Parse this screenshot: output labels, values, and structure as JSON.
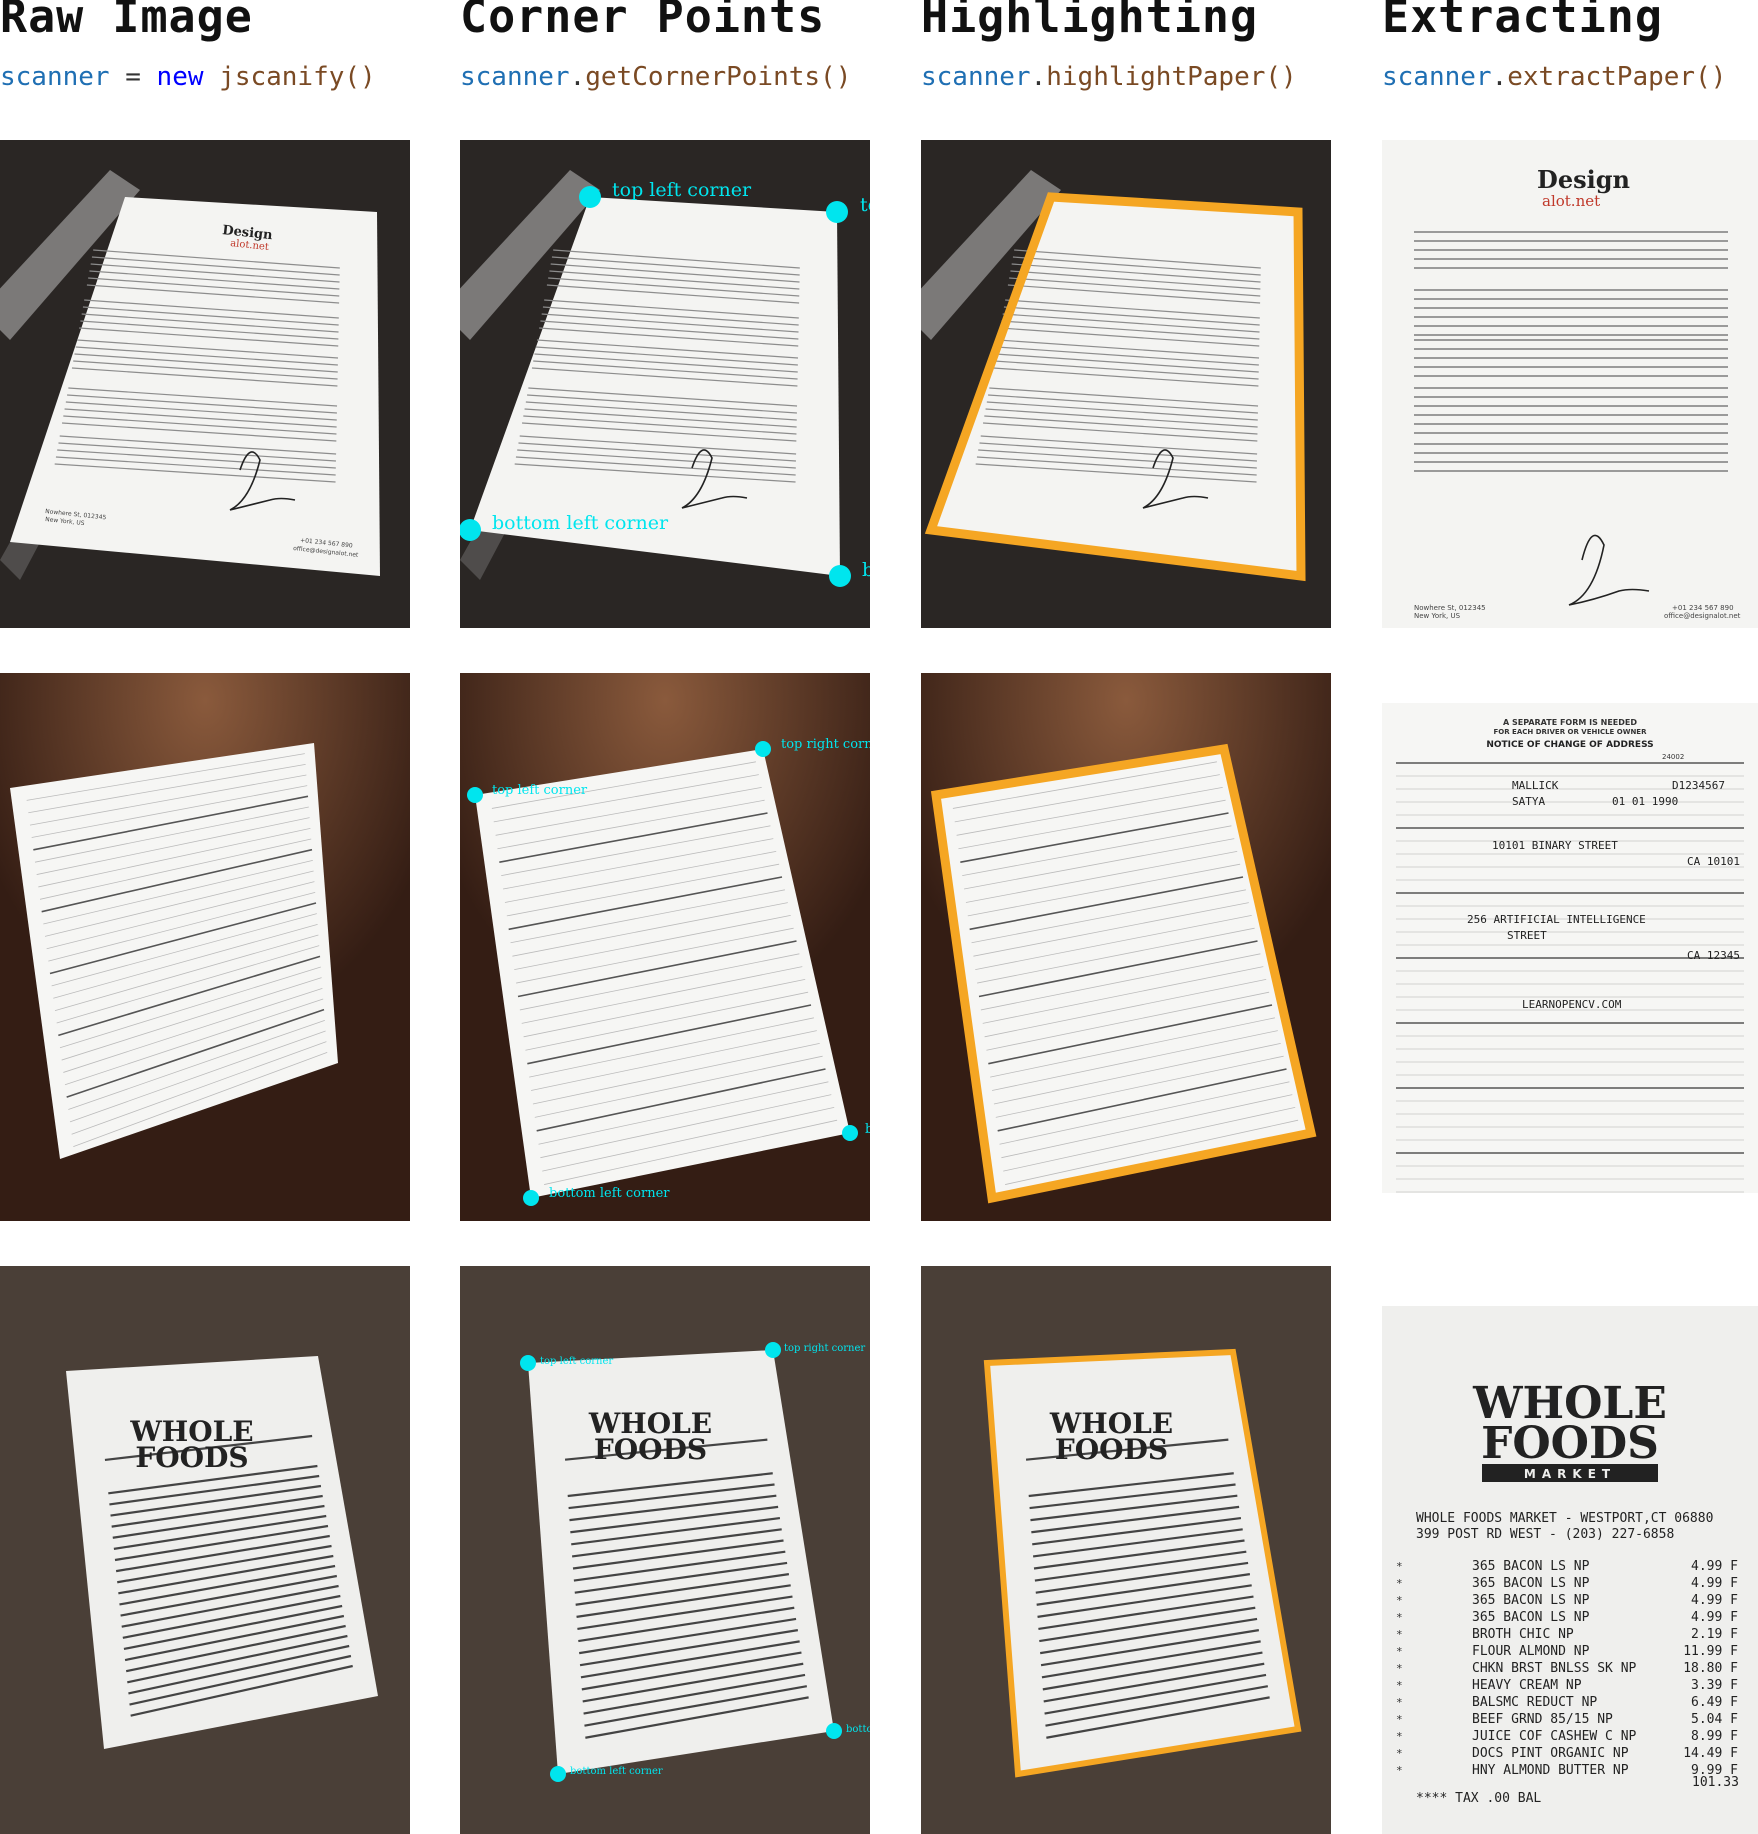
{
  "columns": [
    {
      "title": "Raw Image",
      "code": {
        "var": "scanner",
        "op": " = ",
        "kw": "new",
        "fn": " jscanify()"
      }
    },
    {
      "title": "Corner Points",
      "code": {
        "var": "scanner",
        "op": ".",
        "kw": "",
        "fn": "getCornerPoints()"
      }
    },
    {
      "title": "Highlighting",
      "code": {
        "var": "scanner",
        "op": ".",
        "kw": "",
        "fn": "highlightPaper()"
      }
    },
    {
      "title": "Extracting",
      "code": {
        "var": "scanner",
        "op": ".",
        "kw": "",
        "fn": "extractPaper()"
      }
    }
  ],
  "corner_labels": {
    "top_left": "top left corner",
    "top_right": "top right corner",
    "bottom_left": "bottom left corner",
    "bottom_right": "bottom right corner"
  },
  "colors": {
    "corner_point": "#00e5ee",
    "highlight": "#f5a623",
    "desk_dark": "#2a2624",
    "wood": "#3b2319",
    "receipt_bg": "#4a3f37",
    "paper": "#f4f4f2"
  },
  "letter": {
    "logo_top": "Design",
    "logo_bottom": "alot.net",
    "address": "Nowhere St, 012345",
    "city": "New York, US",
    "phone": "+01 234 567 890",
    "email": "office@designalot.net"
  },
  "form": {
    "header1": "A SEPARATE FORM IS NEEDED",
    "header2": "FOR EACH DRIVER OR VEHICLE OWNER",
    "title": "NOTICE OF CHANGE OF ADDRESS",
    "code": "24002",
    "entries": [
      "MALLICK",
      "D1234567",
      "SATYA",
      "01  01  1990",
      "10101  BINARY  STREET",
      "CA  10101",
      "256  ARTIFICIAL  INTELLIGENCE",
      "STREET",
      "CA  12345",
      "LEARNOPENCV.COM"
    ]
  },
  "receipt": {
    "brand_top": "WHOLE",
    "brand_bottom": "FOODS",
    "market": "MARKET",
    "store": "WHOLE FOODS MARKET - WESTPORT,CT 06880",
    "addr": "399 POST RD WEST - (203) 227-6858",
    "items": [
      {
        "name": "365     BACON LS NP",
        "price": "4.99 F"
      },
      {
        "name": "365     BACON LS NP",
        "price": "4.99 F"
      },
      {
        "name": "365     BACON LS NP",
        "price": "4.99 F"
      },
      {
        "name": "365     BACON LS NP",
        "price": "4.99 F"
      },
      {
        "name": "BROTH CHIC NP",
        "price": "2.19 F"
      },
      {
        "name": "FLOUR ALMOND NP",
        "price": "11.99 F"
      },
      {
        "name": "CHKN BRST BNLSS SK NP",
        "price": "18.80 F"
      },
      {
        "name": "HEAVY CREAM NP",
        "price": "3.39 F"
      },
      {
        "name": "BALSMC REDUCT NP",
        "price": "6.49 F"
      },
      {
        "name": "BEEF  GRND  85/15 NP",
        "price": "5.04 F"
      },
      {
        "name": "JUICE COF CASHEW C NP",
        "price": "8.99 F"
      },
      {
        "name": "DOCS PINT ORGANIC NP",
        "price": "14.49 F"
      },
      {
        "name": "HNY ALMOND BUTTER NP",
        "price": "9.99 F"
      }
    ],
    "total": "101.33",
    "tax_line": "**** TAX    .00     BAL"
  }
}
